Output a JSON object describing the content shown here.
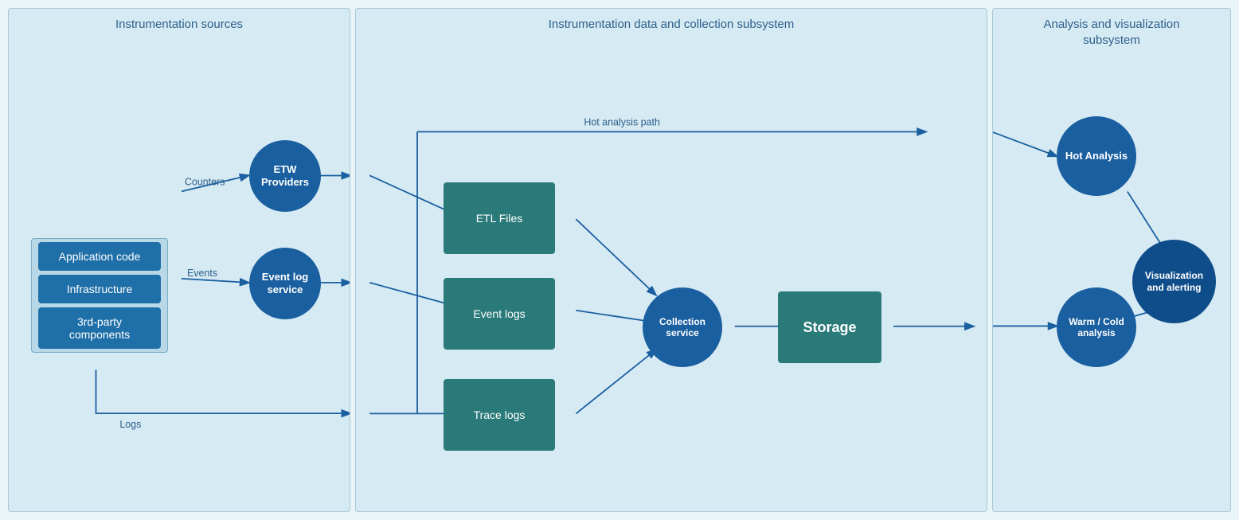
{
  "panels": {
    "sources": {
      "title": "Instrumentation sources",
      "source_boxes": [
        "Application code",
        "Infrastructure",
        "3rd-party components"
      ],
      "etw_label": "ETW\nProviders",
      "event_log_label": "Event log\nservice"
    },
    "data": {
      "title": "Instrumentation data and collection subsystem",
      "etl_label": "ETL Files",
      "event_logs_label": "Event logs",
      "trace_logs_label": "Trace logs",
      "collection_label": "Collection\nservice",
      "storage_label": "Storage",
      "hot_path_label": "Hot analysis path"
    },
    "analysis": {
      "title": "Analysis and visualization\nsubsystem",
      "hot_analysis_label": "Hot Analysis",
      "warm_cold_label": "Warm / Cold\nanalysis",
      "visualization_label": "Visualization\nand alerting"
    }
  },
  "arrows": {
    "counters": "Counters",
    "events": "Events",
    "logs": "Logs",
    "hot_path": "Hot analysis path"
  }
}
